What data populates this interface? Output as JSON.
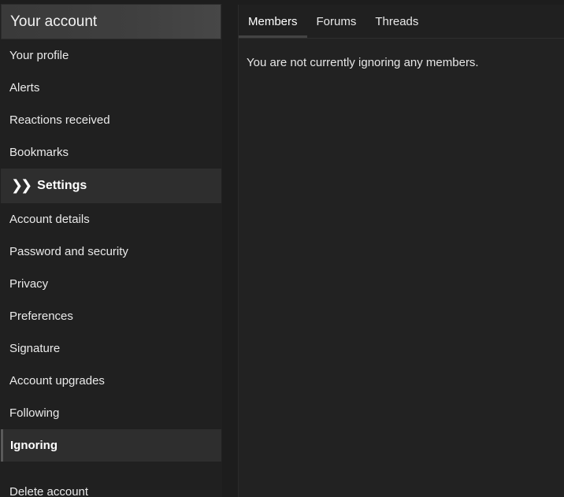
{
  "sidebar": {
    "title": "Your account",
    "account_items": [
      {
        "label": "Your profile"
      },
      {
        "label": "Alerts"
      },
      {
        "label": "Reactions received"
      },
      {
        "label": "Bookmarks"
      }
    ],
    "settings": {
      "icon": "double-chevron-right-icon",
      "label": "Settings",
      "items": [
        {
          "label": "Account details"
        },
        {
          "label": "Password and security"
        },
        {
          "label": "Privacy"
        },
        {
          "label": "Preferences"
        },
        {
          "label": "Signature"
        },
        {
          "label": "Account upgrades"
        },
        {
          "label": "Following"
        },
        {
          "label": "Ignoring",
          "selected": true
        }
      ]
    },
    "delete_account": "Delete account"
  },
  "main": {
    "tabs": [
      {
        "label": "Members",
        "active": true
      },
      {
        "label": "Forums"
      },
      {
        "label": "Threads"
      }
    ],
    "message": "You are not currently ignoring any members."
  },
  "colors": {
    "background": "#1d1d1d",
    "panel": "#222222",
    "selected": "#2e2e2e",
    "text": "#e6e6e6"
  }
}
